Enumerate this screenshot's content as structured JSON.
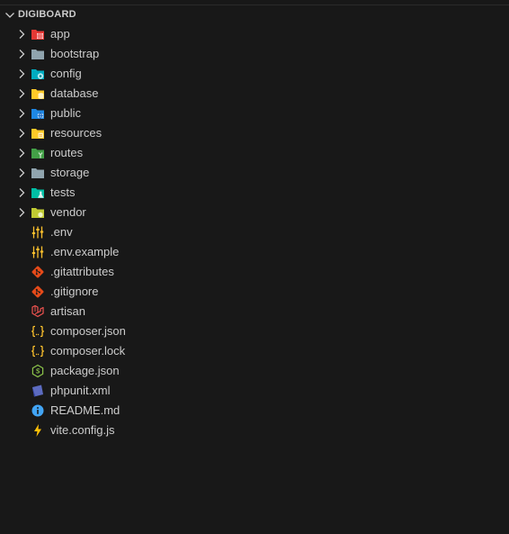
{
  "explorer": {
    "root_title": "DIGIBOARD",
    "folders": [
      {
        "label": "app",
        "icon": "folder-app-icon",
        "color": "#e53935"
      },
      {
        "label": "bootstrap",
        "icon": "folder-icon",
        "color": "#90a4ae"
      },
      {
        "label": "config",
        "icon": "folder-config-icon",
        "color": "#00acc1"
      },
      {
        "label": "database",
        "icon": "folder-database-icon",
        "color": "#ffca28"
      },
      {
        "label": "public",
        "icon": "folder-public-icon",
        "color": "#1e88e5"
      },
      {
        "label": "resources",
        "icon": "folder-resources-icon",
        "color": "#ffca28"
      },
      {
        "label": "routes",
        "icon": "folder-routes-icon",
        "color": "#43a047"
      },
      {
        "label": "storage",
        "icon": "folder-icon",
        "color": "#90a4ae"
      },
      {
        "label": "tests",
        "icon": "folder-tests-icon",
        "color": "#00bfa5"
      },
      {
        "label": "vendor",
        "icon": "folder-vendor-icon",
        "color": "#c0ca33"
      }
    ],
    "files": [
      {
        "label": ".env",
        "icon": "env-settings-icon",
        "color": "#fbc02d"
      },
      {
        "label": ".env.example",
        "icon": "env-settings-icon",
        "color": "#fbc02d"
      },
      {
        "label": ".gitattributes",
        "icon": "git-icon",
        "color": "#e64a19"
      },
      {
        "label": ".gitignore",
        "icon": "git-icon",
        "color": "#e64a19"
      },
      {
        "label": "artisan",
        "icon": "laravel-icon",
        "color": "#ef5350"
      },
      {
        "label": "composer.json",
        "icon": "json-braces-icon",
        "color": "#fbc02d"
      },
      {
        "label": "composer.lock",
        "icon": "json-braces-icon",
        "color": "#fbc02d"
      },
      {
        "label": "package.json",
        "icon": "nodejs-icon",
        "color": "#8bc34a"
      },
      {
        "label": "phpunit.xml",
        "icon": "phpunit-icon",
        "color": "#5c6bc0"
      },
      {
        "label": "README.md",
        "icon": "info-icon",
        "color": "#42a5f5"
      },
      {
        "label": "vite.config.js",
        "icon": "vite-bolt-icon",
        "color": "#ffc107"
      }
    ]
  }
}
